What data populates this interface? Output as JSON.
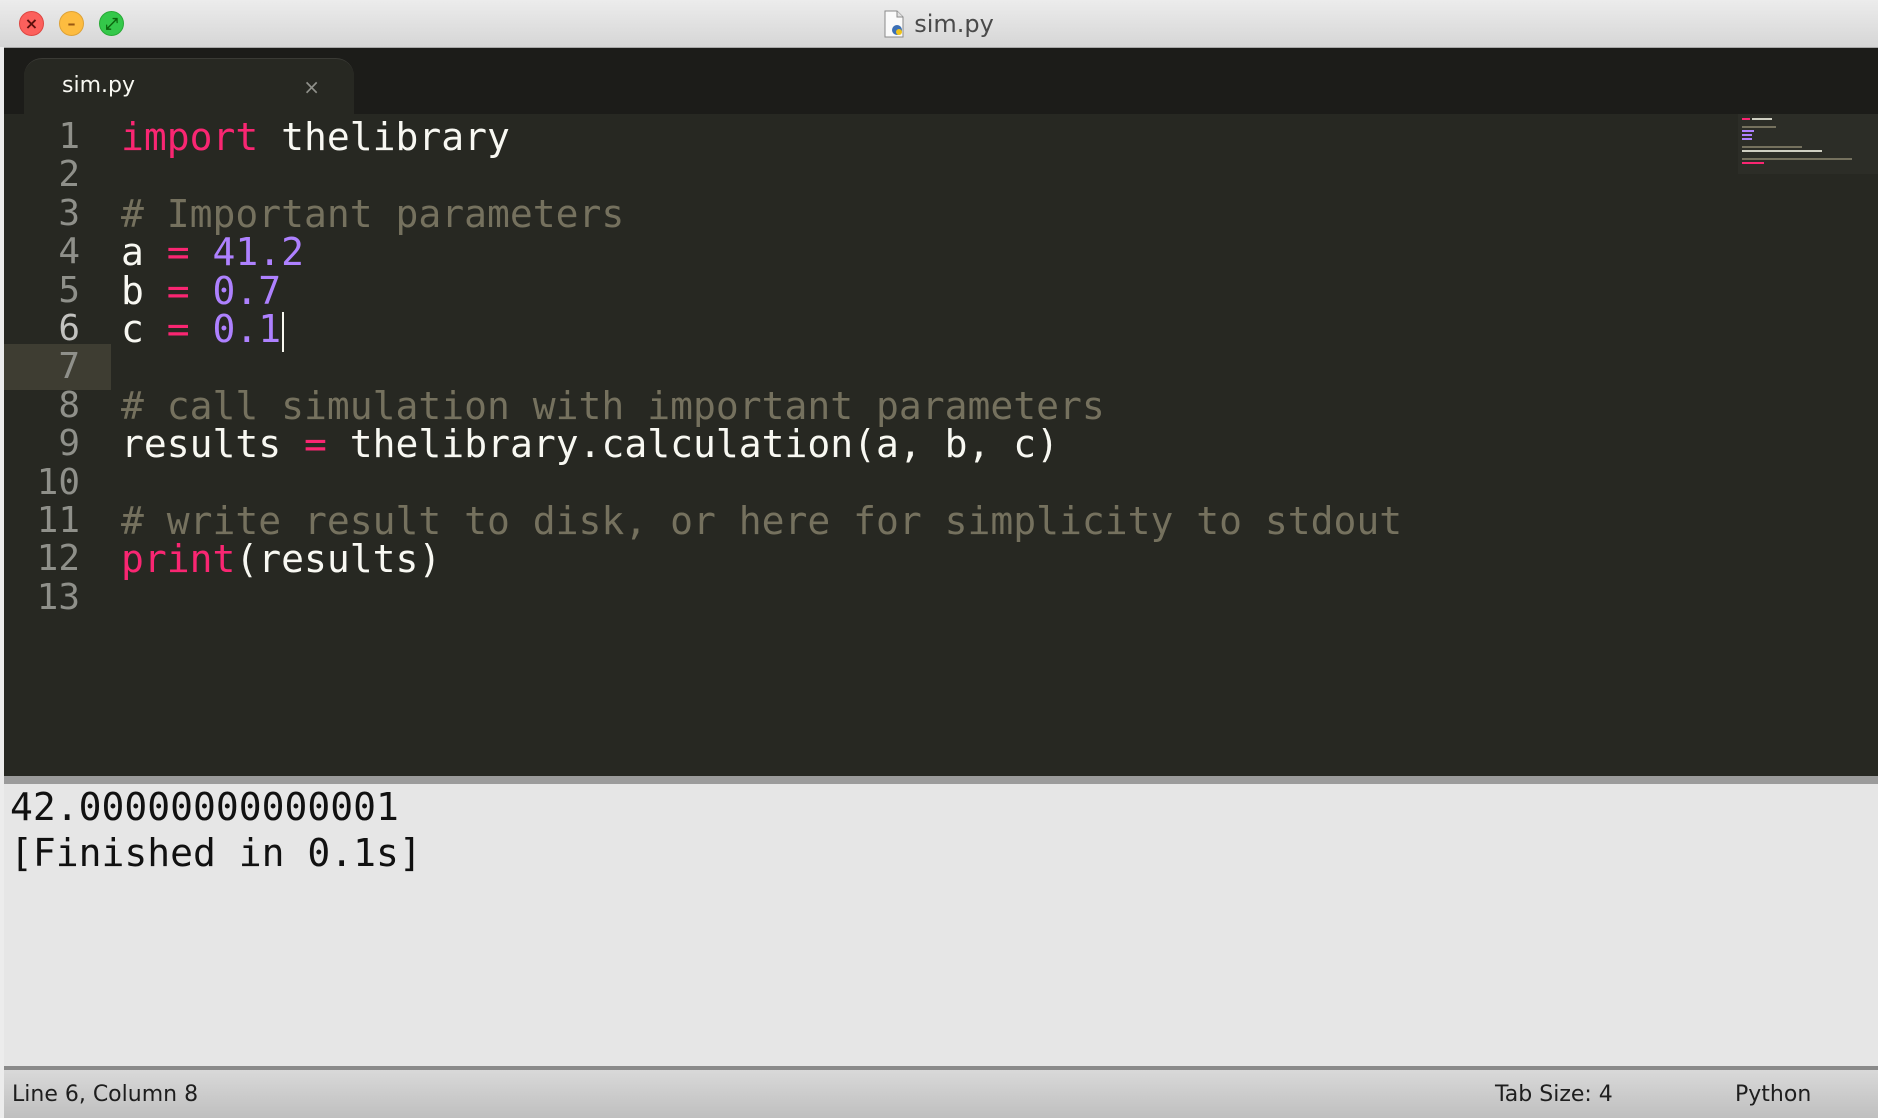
{
  "window": {
    "title": "sim.py"
  },
  "tab": {
    "label": "sim.py",
    "close_glyph": "×"
  },
  "editor": {
    "active_line": 6,
    "line_numbers": [
      "1",
      "2",
      "3",
      "4",
      "5",
      "6",
      "7",
      "8",
      "9",
      "10",
      "11",
      "12",
      "13"
    ],
    "lines": {
      "l1": {
        "kw": "import",
        "rest": " thelibrary"
      },
      "l3": {
        "comment": "# Important parameters"
      },
      "l4": {
        "var": "a ",
        "op": "=",
        "sp": " ",
        "num": "41.2"
      },
      "l5": {
        "var": "b ",
        "op": "=",
        "sp": " ",
        "num": "0.7"
      },
      "l6": {
        "var": "c ",
        "op": "=",
        "sp": " ",
        "num": "0.1"
      },
      "l8": {
        "comment": "# call simulation with important parameters"
      },
      "l9": {
        "var": "results ",
        "op": "=",
        "rest": " thelibrary.calculation(a, b, c)"
      },
      "l11": {
        "comment": "# write result to disk, or here for simplicity to stdout"
      },
      "l12": {
        "kw": "print",
        "rest": "(results)"
      }
    }
  },
  "output": {
    "lines": [
      "42.00000000000001",
      "[Finished in 0.1s]"
    ]
  },
  "status": {
    "position": "Line 6, Column 8",
    "tab_size": "Tab Size: 4",
    "syntax": "Python"
  },
  "colors": {
    "background": "#272822",
    "keyword": "#f92672",
    "number": "#ae81ff",
    "comment": "#75715e",
    "text": "#f8f8f2"
  },
  "icons": [
    "close-icon",
    "minimize-icon",
    "maximize-icon",
    "python-file-icon",
    "tab-close-icon"
  ]
}
